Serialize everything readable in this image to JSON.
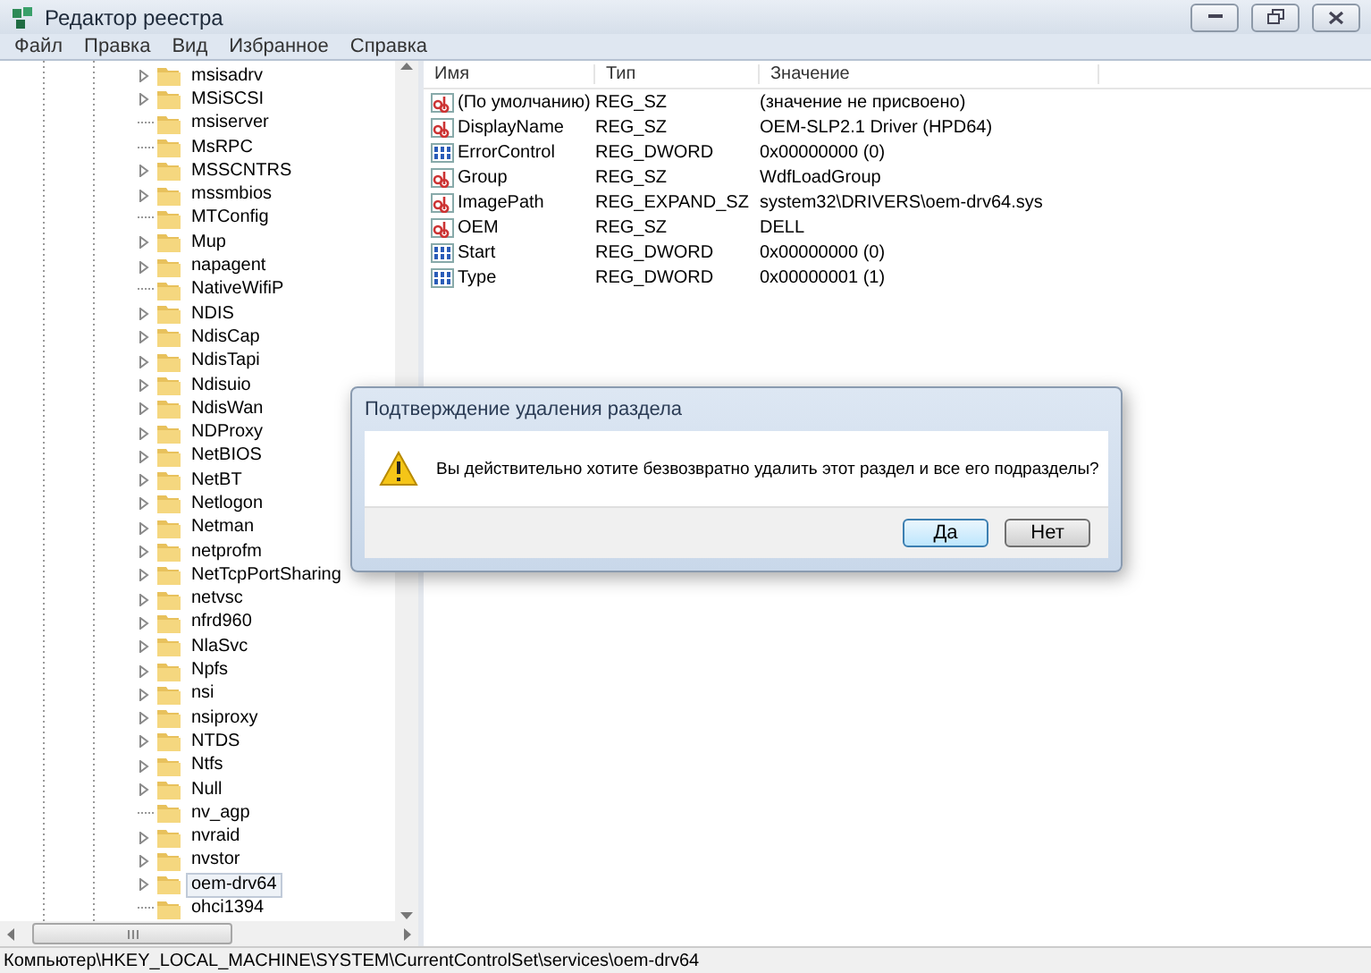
{
  "window": {
    "title": "Редактор реестра"
  },
  "menu": [
    "Файл",
    "Правка",
    "Вид",
    "Избранное",
    "Справка"
  ],
  "tree": {
    "items": [
      {
        "label": "msisadrv",
        "expandable": true,
        "selected": false
      },
      {
        "label": "MSiSCSI",
        "expandable": true,
        "selected": false
      },
      {
        "label": "msiserver",
        "expandable": false,
        "selected": false
      },
      {
        "label": "MsRPC",
        "expandable": false,
        "selected": false
      },
      {
        "label": "MSSCNTRS",
        "expandable": true,
        "selected": false
      },
      {
        "label": "mssmbios",
        "expandable": true,
        "selected": false
      },
      {
        "label": "MTConfig",
        "expandable": false,
        "selected": false
      },
      {
        "label": "Mup",
        "expandable": true,
        "selected": false
      },
      {
        "label": "napagent",
        "expandable": true,
        "selected": false
      },
      {
        "label": "NativeWifiP",
        "expandable": false,
        "selected": false
      },
      {
        "label": "NDIS",
        "expandable": true,
        "selected": false
      },
      {
        "label": "NdisCap",
        "expandable": true,
        "selected": false
      },
      {
        "label": "NdisTapi",
        "expandable": true,
        "selected": false
      },
      {
        "label": "Ndisuio",
        "expandable": true,
        "selected": false
      },
      {
        "label": "NdisWan",
        "expandable": true,
        "selected": false
      },
      {
        "label": "NDProxy",
        "expandable": true,
        "selected": false
      },
      {
        "label": "NetBIOS",
        "expandable": true,
        "selected": false
      },
      {
        "label": "NetBT",
        "expandable": true,
        "selected": false
      },
      {
        "label": "Netlogon",
        "expandable": true,
        "selected": false
      },
      {
        "label": "Netman",
        "expandable": true,
        "selected": false
      },
      {
        "label": "netprofm",
        "expandable": true,
        "selected": false
      },
      {
        "label": "NetTcpPortSharing",
        "expandable": true,
        "selected": false
      },
      {
        "label": "netvsc",
        "expandable": true,
        "selected": false
      },
      {
        "label": "nfrd960",
        "expandable": true,
        "selected": false
      },
      {
        "label": "NlaSvc",
        "expandable": true,
        "selected": false
      },
      {
        "label": "Npfs",
        "expandable": true,
        "selected": false
      },
      {
        "label": "nsi",
        "expandable": true,
        "selected": false
      },
      {
        "label": "nsiproxy",
        "expandable": true,
        "selected": false
      },
      {
        "label": "NTDS",
        "expandable": true,
        "selected": false
      },
      {
        "label": "Ntfs",
        "expandable": true,
        "selected": false
      },
      {
        "label": "Null",
        "expandable": true,
        "selected": false
      },
      {
        "label": "nv_agp",
        "expandable": false,
        "selected": false
      },
      {
        "label": "nvraid",
        "expandable": true,
        "selected": false
      },
      {
        "label": "nvstor",
        "expandable": true,
        "selected": false
      },
      {
        "label": "oem-drv64",
        "expandable": true,
        "selected": true
      },
      {
        "label": "ohci1394",
        "expandable": false,
        "selected": false
      }
    ]
  },
  "values": {
    "columns": [
      "Имя",
      "Тип",
      "Значение"
    ],
    "rows": [
      {
        "kind": "string",
        "name": "(По умолчанию)",
        "type": "REG_SZ",
        "data": "(значение не присвоено)"
      },
      {
        "kind": "string",
        "name": "DisplayName",
        "type": "REG_SZ",
        "data": "OEM-SLP2.1 Driver (HPD64)"
      },
      {
        "kind": "binary",
        "name": "ErrorControl",
        "type": "REG_DWORD",
        "data": "0x00000000 (0)"
      },
      {
        "kind": "string",
        "name": "Group",
        "type": "REG_SZ",
        "data": "WdfLoadGroup"
      },
      {
        "kind": "string",
        "name": "ImagePath",
        "type": "REG_EXPAND_SZ",
        "data": "system32\\DRIVERS\\oem-drv64.sys"
      },
      {
        "kind": "string",
        "name": "OEM",
        "type": "REG_SZ",
        "data": "DELL"
      },
      {
        "kind": "binary",
        "name": "Start",
        "type": "REG_DWORD",
        "data": "0x00000000 (0)"
      },
      {
        "kind": "binary",
        "name": "Type",
        "type": "REG_DWORD",
        "data": "0x00000001 (1)"
      }
    ]
  },
  "dialog": {
    "title": "Подтверждение удаления раздела",
    "message": "Вы действительно хотите безвозвратно удалить этот раздел и все его подразделы?",
    "buttons": [
      {
        "label": "Да",
        "default": true
      },
      {
        "label": "Нет",
        "default": false
      }
    ]
  },
  "status_bar": "Компьютер\\HKEY_LOCAL_MACHINE\\SYSTEM\\CurrentControlSet\\services\\oem-drv64"
}
